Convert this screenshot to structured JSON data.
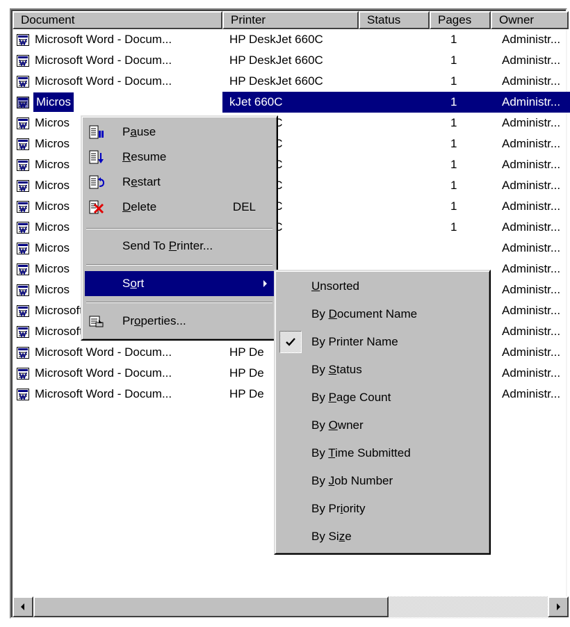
{
  "columns": [
    "Document",
    "Printer",
    "Status",
    "Pages",
    "Owner"
  ],
  "jobs": [
    {
      "document": "Microsoft Word - Docum...",
      "printer": "HP DeskJet 660C",
      "status": "",
      "pages": "1",
      "owner": "Administr..."
    },
    {
      "document": "Microsoft Word - Docum...",
      "printer": "HP DeskJet 660C",
      "status": "",
      "pages": "1",
      "owner": "Administr..."
    },
    {
      "document": "Microsoft Word - Docum...",
      "printer": "HP DeskJet 660C",
      "status": "",
      "pages": "1",
      "owner": "Administr..."
    },
    {
      "document": "Micros",
      "printer": "kJet 660C",
      "status": "",
      "pages": "1",
      "owner": "Administr...",
      "selected": true
    },
    {
      "document": "Micros",
      "printer": "kJet 660C",
      "status": "",
      "pages": "1",
      "owner": "Administr..."
    },
    {
      "document": "Micros",
      "printer": "kJet 660C",
      "status": "",
      "pages": "1",
      "owner": "Administr..."
    },
    {
      "document": "Micros",
      "printer": "kJet 660C",
      "status": "",
      "pages": "1",
      "owner": "Administr..."
    },
    {
      "document": "Micros",
      "printer": "kJet 660C",
      "status": "",
      "pages": "1",
      "owner": "Administr..."
    },
    {
      "document": "Micros",
      "printer": "kJet 660C",
      "status": "",
      "pages": "1",
      "owner": "Administr..."
    },
    {
      "document": "Micros",
      "printer": "kJet 660C",
      "status": "",
      "pages": "1",
      "owner": "Administr..."
    },
    {
      "document": "Micros",
      "printer": "",
      "status": "",
      "pages": "",
      "owner": "Administr..."
    },
    {
      "document": "Micros",
      "printer": "",
      "status": "",
      "pages": "",
      "owner": "Administr..."
    },
    {
      "document": "Micros",
      "printer": "",
      "status": "",
      "pages": "",
      "owner": "Administr..."
    },
    {
      "document": "Microsoft Word - Docum...",
      "printer": "HP De",
      "status": "",
      "pages": "",
      "owner": "Administr..."
    },
    {
      "document": "Microsoft Word - Docum...",
      "printer": "HP De",
      "status": "",
      "pages": "",
      "owner": "Administr..."
    },
    {
      "document": "Microsoft Word - Docum...",
      "printer": "HP De",
      "status": "",
      "pages": "",
      "owner": "Administr..."
    },
    {
      "document": "Microsoft Word - Docum...",
      "printer": "HP De",
      "status": "",
      "pages": "",
      "owner": "Administr..."
    },
    {
      "document": "Microsoft Word - Docum...",
      "printer": "HP De",
      "status": "",
      "pages": "",
      "owner": "Administr..."
    }
  ],
  "context_menu": {
    "pause": {
      "pre": "P",
      "key": "a",
      "post": "use"
    },
    "resume": {
      "pre": "",
      "key": "R",
      "post": "esume"
    },
    "restart": {
      "pre": "R",
      "key": "e",
      "post": "start"
    },
    "delete": {
      "pre": "",
      "key": "D",
      "post": "elete",
      "accel": "DEL"
    },
    "send_to_printer": {
      "pre": "Send To ",
      "key": "P",
      "post": "rinter..."
    },
    "sort": {
      "pre": "S",
      "key": "o",
      "post": "rt"
    },
    "properties": {
      "pre": "Pr",
      "key": "o",
      "post": "perties..."
    }
  },
  "sort_menu": [
    {
      "pre": "",
      "key": "U",
      "post": "nsorted",
      "checked": false
    },
    {
      "pre": "By ",
      "key": "D",
      "post": "ocument Name",
      "checked": false
    },
    {
      "pre": "By Printer Name",
      "key": "",
      "post": "",
      "checked": true
    },
    {
      "pre": "By ",
      "key": "S",
      "post": "tatus",
      "checked": false
    },
    {
      "pre": "By ",
      "key": "P",
      "post": "age Count",
      "checked": false
    },
    {
      "pre": "By ",
      "key": "O",
      "post": "wner",
      "checked": false
    },
    {
      "pre": "By ",
      "key": "T",
      "post": "ime Submitted",
      "checked": false
    },
    {
      "pre": "By ",
      "key": "J",
      "post": "ob Number",
      "checked": false
    },
    {
      "pre": "By Pr",
      "key": "i",
      "post": "ority",
      "checked": false
    },
    {
      "pre": "By Si",
      "key": "z",
      "post": "e",
      "checked": false
    }
  ],
  "scrollbar": {
    "thumb_fraction": 0.69
  },
  "colors": {
    "highlight": "#000080",
    "face": "#c0c0c0"
  }
}
